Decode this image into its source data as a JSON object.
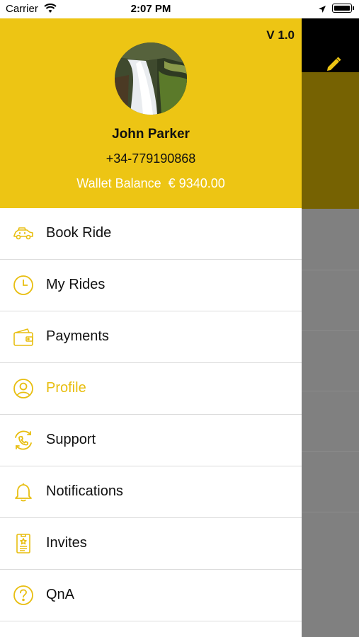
{
  "status_bar": {
    "carrier": "Carrier",
    "time": "2:07 PM"
  },
  "app": {
    "version": "V 1.0"
  },
  "user": {
    "name": "John Parker",
    "phone": "+34-779190868",
    "wallet_label": "Wallet Balance",
    "wallet_amount": "€ 9340.00"
  },
  "menu": {
    "items": [
      {
        "label": "Book Ride",
        "icon": "car-icon"
      },
      {
        "label": "My Rides",
        "icon": "clock-icon"
      },
      {
        "label": "Payments",
        "icon": "wallet-icon"
      },
      {
        "label": "Profile",
        "icon": "user-icon",
        "active": true
      },
      {
        "label": "Support",
        "icon": "phone-support-icon"
      },
      {
        "label": "Notifications",
        "icon": "bell-icon"
      },
      {
        "label": "Invites",
        "icon": "invite-card-icon"
      },
      {
        "label": "QnA",
        "icon": "question-icon"
      }
    ]
  },
  "colors": {
    "accent": "#EDC514",
    "active_text": "#E8BE10",
    "overlay": "#808080"
  }
}
